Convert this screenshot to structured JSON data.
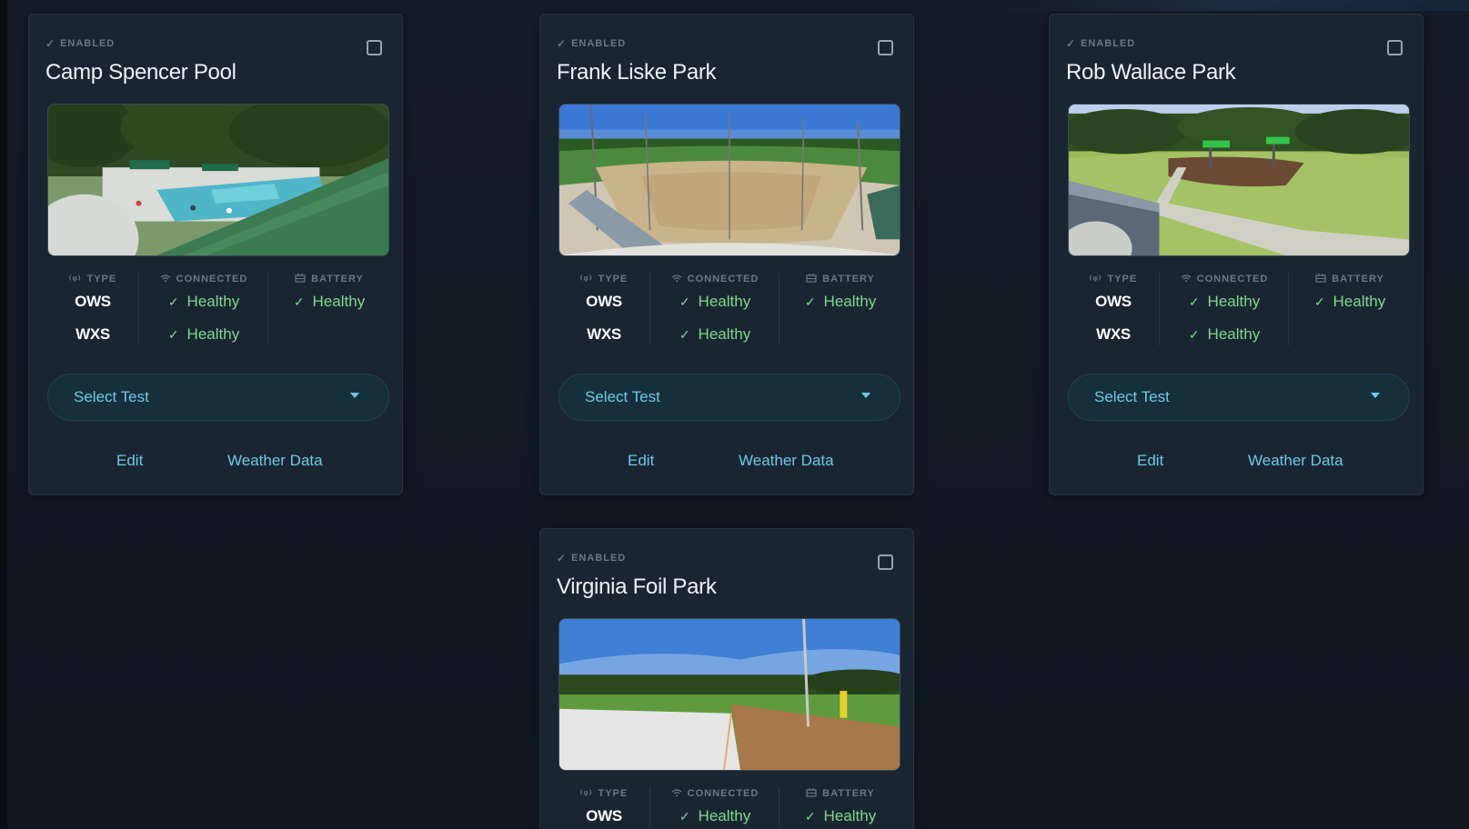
{
  "cards": [
    {
      "enabled_label": "ENABLED",
      "title": "Camp Spencer Pool",
      "scene": "pool",
      "headers": {
        "type": "TYPE",
        "connected": "CONNECTED",
        "battery": "BATTERY"
      },
      "rows": [
        {
          "type": "OWS",
          "connected": "Healthy",
          "battery": "Healthy"
        },
        {
          "type": "WXS",
          "connected": "Healthy",
          "battery": ""
        }
      ],
      "select_test_label": "Select Test",
      "edit_label": "Edit",
      "weather_label": "Weather Data"
    },
    {
      "enabled_label": "ENABLED",
      "title": "Frank Liske Park",
      "scene": "baseball",
      "headers": {
        "type": "TYPE",
        "connected": "CONNECTED",
        "battery": "BATTERY"
      },
      "rows": [
        {
          "type": "OWS",
          "connected": "Healthy",
          "battery": "Healthy"
        },
        {
          "type": "WXS",
          "connected": "Healthy",
          "battery": ""
        }
      ],
      "select_test_label": "Select Test",
      "edit_label": "Edit",
      "weather_label": "Weather Data"
    },
    {
      "enabled_label": "ENABLED",
      "title": "Rob Wallace Park",
      "scene": "playground",
      "headers": {
        "type": "TYPE",
        "connected": "CONNECTED",
        "battery": "BATTERY"
      },
      "rows": [
        {
          "type": "OWS",
          "connected": "Healthy",
          "battery": "Healthy"
        },
        {
          "type": "WXS",
          "connected": "Healthy",
          "battery": ""
        }
      ],
      "select_test_label": "Select Test",
      "edit_label": "Edit",
      "weather_label": "Weather Data"
    },
    {
      "enabled_label": "ENABLED",
      "title": "Virginia Foil Park",
      "scene": "field",
      "headers": {
        "type": "TYPE",
        "connected": "CONNECTED",
        "battery": "BATTERY"
      },
      "rows": [
        {
          "type": "OWS",
          "connected": "Healthy",
          "battery": "Healthy"
        }
      ]
    }
  ],
  "colors": {
    "background": "#121a25",
    "card": "#1a2532",
    "healthy": "#7fd98a",
    "link": "#6ec9e6",
    "muted": "#6b7786"
  },
  "icons": {
    "enabled": "check-icon",
    "type": "antenna-icon",
    "connected": "wifi-icon",
    "battery": "battery-icon",
    "healthy": "check-icon",
    "dropdown": "caret-down-icon"
  }
}
